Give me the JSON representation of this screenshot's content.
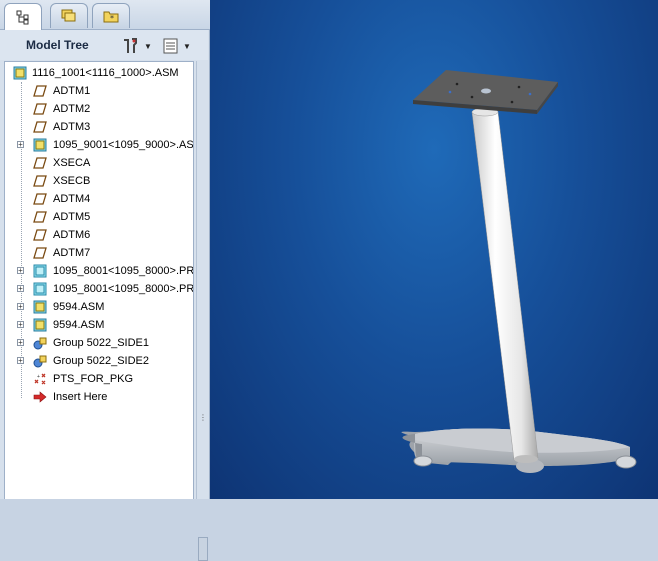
{
  "model_tree": {
    "title": "Model Tree",
    "tabs": [
      {
        "name": "model-tree",
        "icon": "model-tree-icon"
      },
      {
        "name": "layers",
        "icon": "layers-icon"
      },
      {
        "name": "favorites",
        "icon": "folder-icon"
      }
    ],
    "items": [
      {
        "label": "1116_1001<1116_1000>.ASM",
        "icon": "assembly-icon",
        "root": true
      },
      {
        "label": "ADTM1",
        "icon": "datum-plane-icon"
      },
      {
        "label": "ADTM2",
        "icon": "datum-plane-icon"
      },
      {
        "label": "ADTM3",
        "icon": "datum-plane-icon"
      },
      {
        "label": "1095_9001<1095_9000>.AS",
        "icon": "assembly-icon",
        "expandable": true
      },
      {
        "label": "XSECA",
        "icon": "datum-plane-icon"
      },
      {
        "label": "XSECB",
        "icon": "datum-plane-icon"
      },
      {
        "label": "ADTM4",
        "icon": "datum-plane-icon"
      },
      {
        "label": "ADTM5",
        "icon": "datum-plane-icon"
      },
      {
        "label": "ADTM6",
        "icon": "datum-plane-icon"
      },
      {
        "label": "ADTM7",
        "icon": "datum-plane-icon"
      },
      {
        "label": "1095_8001<1095_8000>.PR",
        "icon": "part-icon",
        "expandable": true
      },
      {
        "label": "1095_8001<1095_8000>.PR",
        "icon": "part-icon",
        "expandable": true
      },
      {
        "label": "9594.ASM",
        "icon": "assembly-icon",
        "expandable": true
      },
      {
        "label": "9594.ASM",
        "icon": "assembly-icon",
        "expandable": true
      },
      {
        "label": "Group 5022_SIDE1",
        "icon": "group-icon",
        "expandable": true
      },
      {
        "label": "Group 5022_SIDE2",
        "icon": "group-icon",
        "expandable": true
      },
      {
        "label": "PTS_FOR_PKG",
        "icon": "datum-points-icon"
      },
      {
        "label": "Insert Here",
        "icon": "insert-arrow-icon"
      }
    ]
  },
  "colors": {
    "viewport_bg": "#164f99",
    "plate": "#5a5a5a",
    "column": "#e8e8e8",
    "base": "#b8bcc2"
  }
}
